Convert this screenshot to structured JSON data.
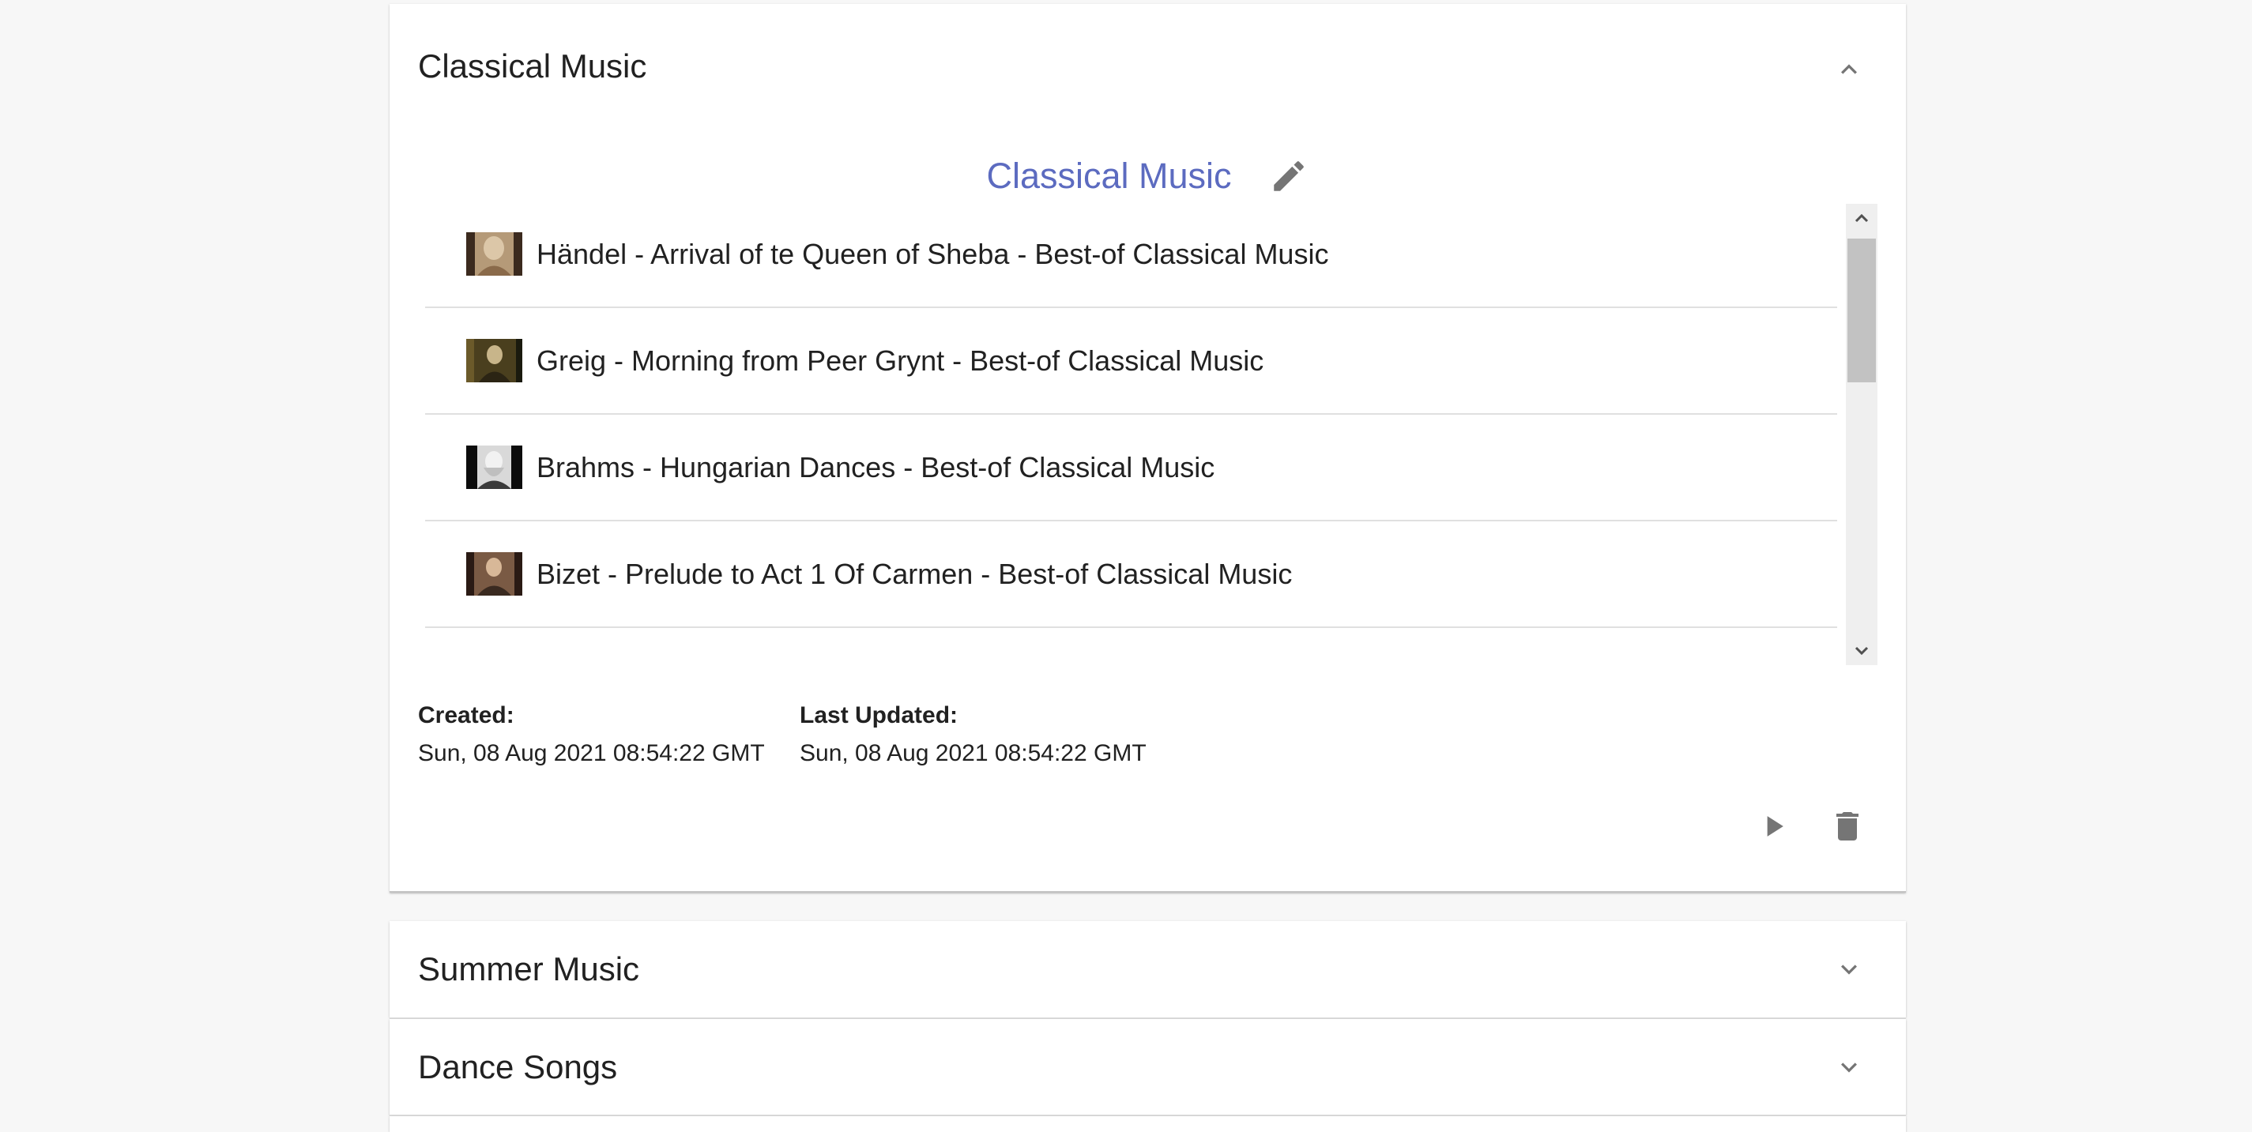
{
  "playlists": [
    {
      "title": "Classical Music",
      "expanded": true,
      "display_name": "Classical Music",
      "tracks": [
        {
          "title": "Händel - Arrival of te Queen of Sheba - Best-of Classical Music"
        },
        {
          "title": "Greig - Morning from Peer Grynt - Best-of Classical Music"
        },
        {
          "title": "Brahms - Hungarian Dances - Best-of Classical Music"
        },
        {
          "title": "Bizet - Prelude to Act 1 Of Carmen - Best-of Classical Music"
        }
      ],
      "meta": {
        "created_label": "Created:",
        "created_value": "Sun, 08 Aug 2021 08:54:22 GMT",
        "updated_label": "Last Updated:",
        "updated_value": "Sun, 08 Aug 2021 08:54:22 GMT"
      }
    },
    {
      "title": "Summer Music",
      "expanded": false
    },
    {
      "title": "Dance Songs",
      "expanded": false
    }
  ],
  "icons": {
    "collapse": "chevron-up-icon",
    "expand": "chevron-down-icon",
    "edit": "pencil-icon",
    "play": "play-icon",
    "delete": "trash-icon"
  },
  "colors": {
    "accent": "#5c6bc0",
    "icon": "#757575",
    "background": "#f7f7f7",
    "panel": "#ffffff"
  }
}
